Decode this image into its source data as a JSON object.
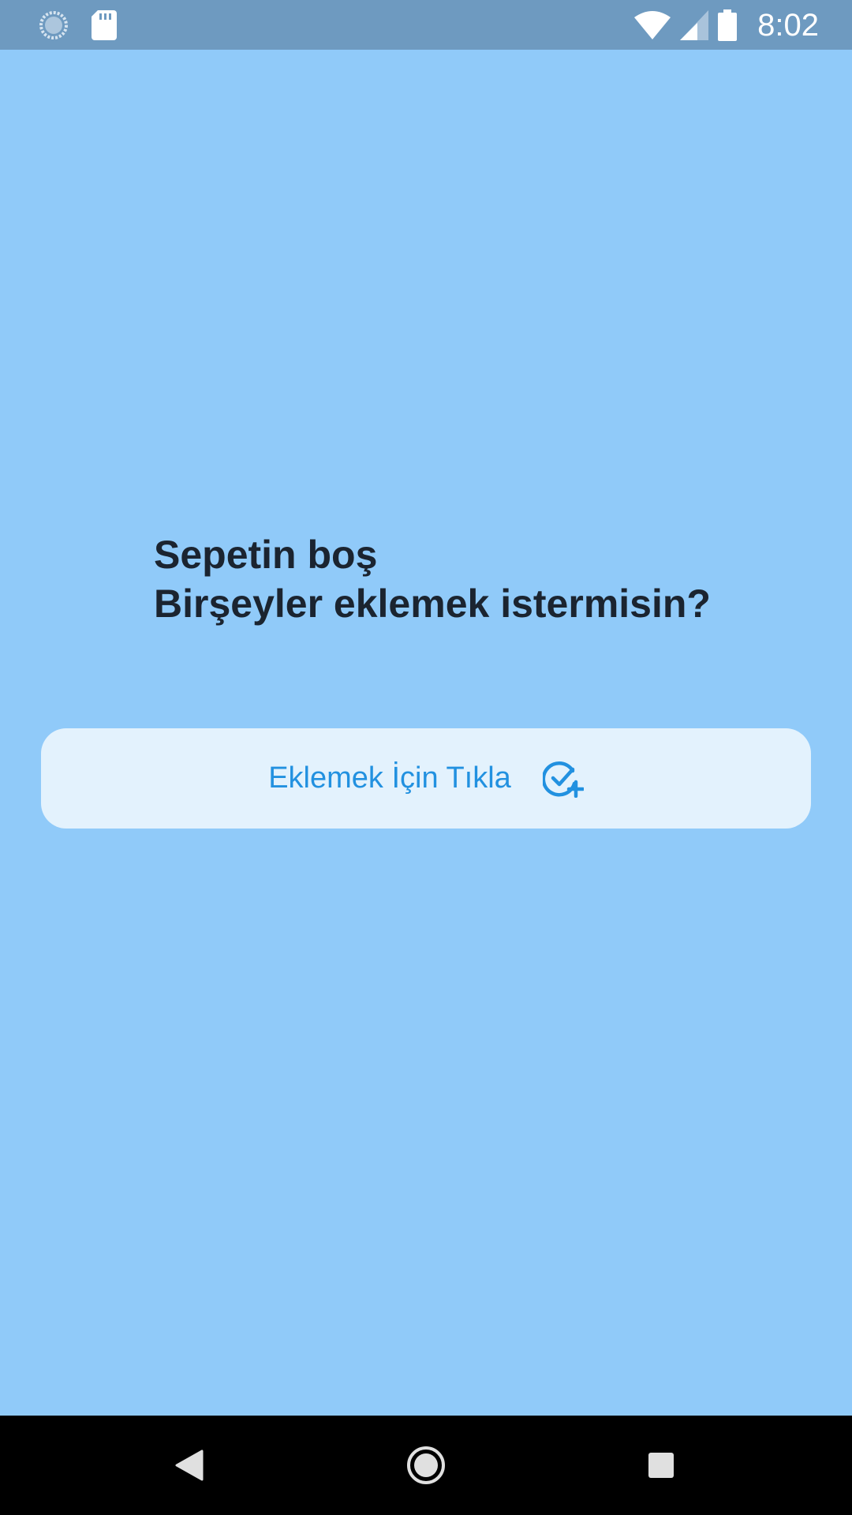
{
  "status_bar": {
    "time": "8:02",
    "left_icons": [
      "loading-circle-icon",
      "sd-card-icon"
    ],
    "right_icons": [
      "wifi-icon",
      "cell-signal-icon",
      "battery-icon"
    ]
  },
  "empty_cart": {
    "line1": "Sepetin boş",
    "line2": "Birşeyler eklemek istermisin?"
  },
  "add_button": {
    "label": "Eklemek İçin Tıkla",
    "icon": "check-circle-plus-icon"
  },
  "nav_bar": {
    "buttons": [
      "back-icon",
      "home-icon",
      "recents-icon"
    ]
  },
  "colors": {
    "background": "#90CAF9",
    "status_bar": "#6E9AC0",
    "button_bg": "#E3F2FD",
    "accent": "#2291E0",
    "text": "#1B2430"
  }
}
